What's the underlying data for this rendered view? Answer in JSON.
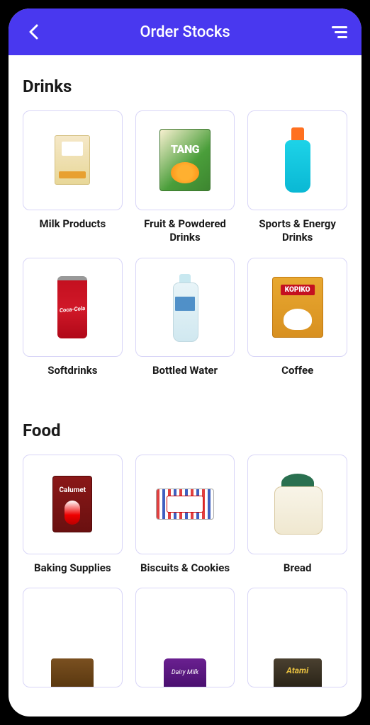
{
  "header": {
    "title": "Order Stocks"
  },
  "sections": [
    {
      "title": "Drinks",
      "items": [
        {
          "label": "Milk Products",
          "icon": "milk-box"
        },
        {
          "label": "Fruit & Powdered Drinks",
          "icon": "tang-pack"
        },
        {
          "label": "Sports & Energy Drinks",
          "icon": "sports-bottle"
        },
        {
          "label": "Softdrinks",
          "icon": "coke-can"
        },
        {
          "label": "Bottled Water",
          "icon": "water-bottle"
        },
        {
          "label": "Coffee",
          "icon": "coffee-pack"
        }
      ]
    },
    {
      "title": "Food",
      "items": [
        {
          "label": "Baking Supplies",
          "icon": "calumet-pack"
        },
        {
          "label": "Biscuits & Cookies",
          "icon": "biscuit-pack"
        },
        {
          "label": "Bread",
          "icon": "bread-pack"
        }
      ]
    }
  ]
}
